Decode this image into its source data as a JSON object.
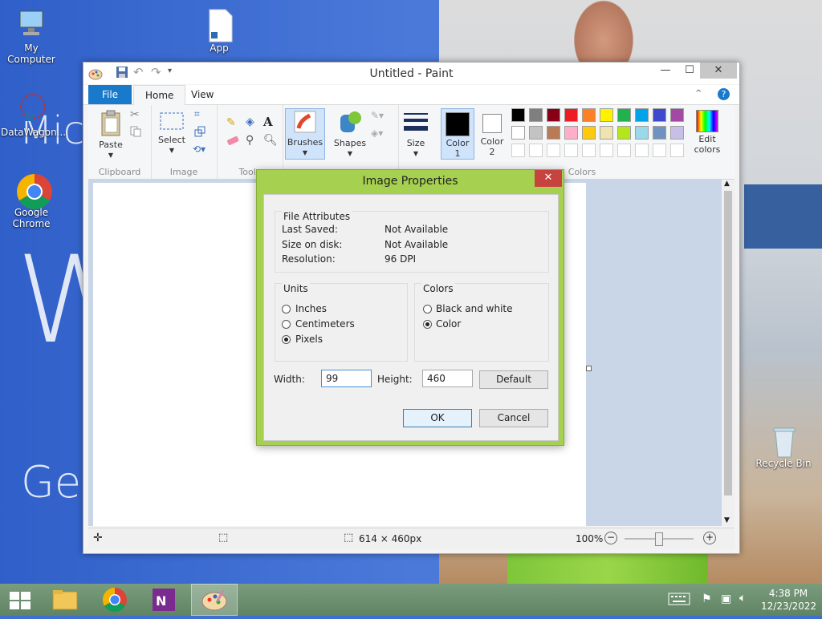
{
  "desktop": {
    "icons": [
      {
        "label": "My Computer"
      },
      {
        "label": "App"
      },
      {
        "label": "DataWagon..."
      },
      {
        "label": "Google\nChrome"
      },
      {
        "label": "Recycle Bin"
      }
    ],
    "bg_text": {
      "line1": "Microso",
      "line2": "Wi",
      "line3": "Get the"
    }
  },
  "paint": {
    "title": "Untitled - Paint",
    "tabs": {
      "file": "File",
      "home": "Home",
      "view": "View"
    },
    "ribbon": {
      "clipboard": {
        "paste": "Paste",
        "label": "Clipboard"
      },
      "image": {
        "select": "Select",
        "label": "Image"
      },
      "tools": {
        "label": "Tools"
      },
      "brushes": "Brushes",
      "shapes": "Shapes",
      "size": "Size",
      "color1": "Color\n1",
      "color2": "Color\n2",
      "edit_colors": "Edit\ncolors",
      "colors_label": "Colors"
    },
    "palette_row1": [
      "#000000",
      "#7f7f7f",
      "#880015",
      "#ed1c24",
      "#ff7f27",
      "#fff200",
      "#22b14c",
      "#00a2e8",
      "#3f48cc",
      "#a349a4"
    ],
    "palette_row2": [
      "#ffffff",
      "#c3c3c3",
      "#b97a57",
      "#ffaec9",
      "#ffc90e",
      "#efe4b0",
      "#b5e61d",
      "#99d9ea",
      "#7092be",
      "#c8bfe7"
    ],
    "status": {
      "size": "614 × 460px",
      "zoom": "100%"
    }
  },
  "dialog": {
    "title": "Image Properties",
    "file_attributes": {
      "legend": "File Attributes",
      "last_saved_label": "Last Saved:",
      "last_saved_value": "Not Available",
      "size_label": "Size on disk:",
      "size_value": "Not Available",
      "resolution_label": "Resolution:",
      "resolution_value": "96 DPI"
    },
    "units": {
      "legend": "Units",
      "inches": "Inches",
      "centimeters": "Centimeters",
      "pixels": "Pixels",
      "selected": "pixels"
    },
    "colors": {
      "legend": "Colors",
      "bw": "Black and white",
      "color": "Color",
      "selected": "color"
    },
    "width_label": "Width:",
    "width_value": "99",
    "height_label": "Height:",
    "height_value": "460",
    "default_button": "Default",
    "ok_button": "OK",
    "cancel_button": "Cancel"
  },
  "taskbar": {
    "time": "4:38 PM",
    "date": "12/23/2022"
  }
}
